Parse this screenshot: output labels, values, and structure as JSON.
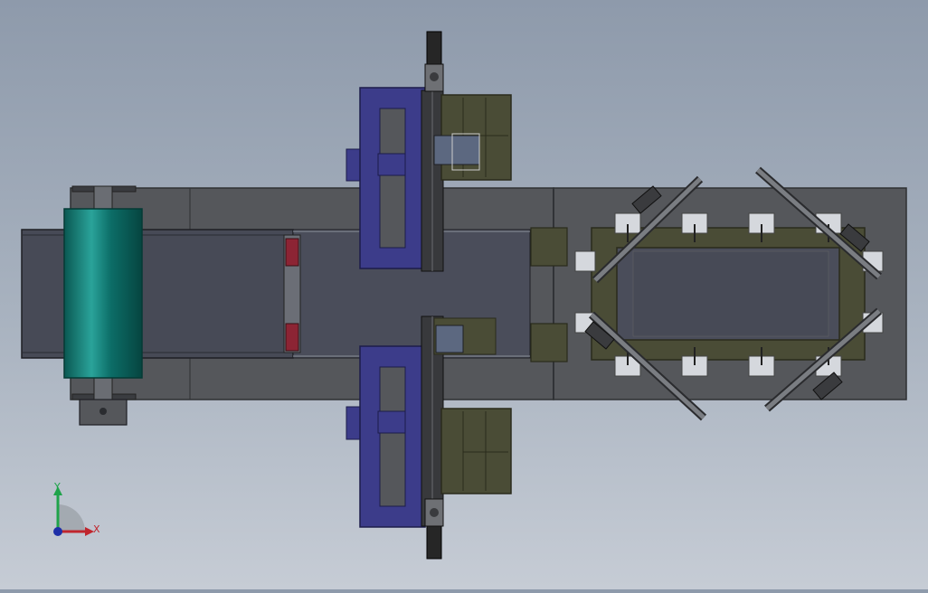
{
  "viewport": {
    "background_top": "#8e9aab",
    "background_bottom": "#c6ccd5"
  },
  "colors": {
    "base_plate": "#55575b",
    "base_plate_edge": "#2e3033",
    "conveyor_belt": "#474a56",
    "roller": "#0c6d67",
    "roller_highlight": "#2aa39a",
    "gantry_frame": "#3c3c8a",
    "gantry_edge": "#1c1c4a",
    "olive_panel": "#4a4c36",
    "olive_edge": "#2a2b1c",
    "red_block": "#8c2434",
    "fixture_white": "#d5d8dd",
    "motor": "#262626"
  },
  "triad": {
    "y_label": "Y",
    "x_label": "X",
    "y_color": "#1fa34a",
    "x_color": "#c0262e",
    "z_color": "#1e2fa8"
  }
}
